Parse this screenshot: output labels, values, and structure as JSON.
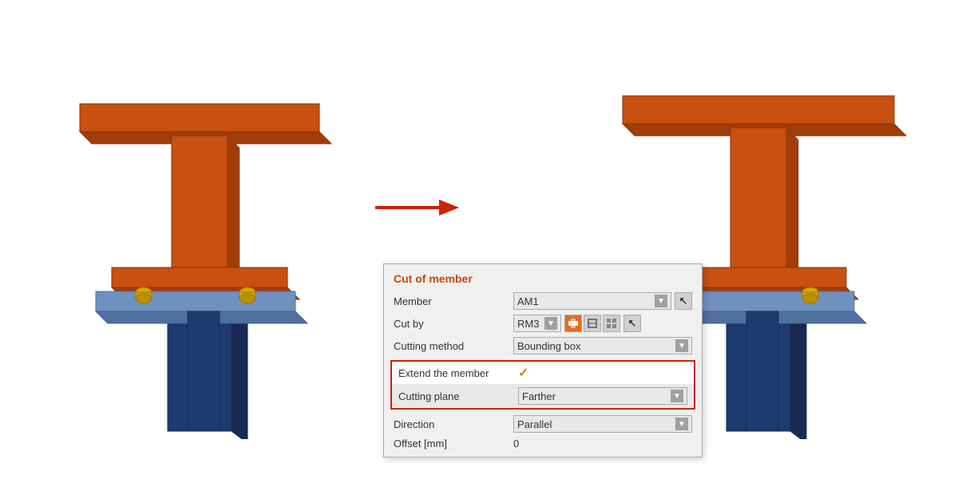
{
  "dialog": {
    "title": "Cut of member",
    "rows": [
      {
        "label": "Member",
        "value": "AM1",
        "type": "select"
      },
      {
        "label": "Cut by",
        "value": "RM3",
        "type": "select-icons"
      },
      {
        "label": "Cutting method",
        "value": "Bounding box",
        "type": "select"
      },
      {
        "label": "Extend the member",
        "value": "✓",
        "type": "check",
        "highlighted": true
      },
      {
        "label": "Cutting plane",
        "value": "Farther",
        "type": "select",
        "highlighted": true
      },
      {
        "label": "Direction",
        "value": "Parallel",
        "type": "select"
      },
      {
        "label": "Offset [mm]",
        "value": "0",
        "type": "text"
      }
    ]
  },
  "arrow": "→",
  "colors": {
    "beam_orange": "#c85010",
    "beam_plate_dark": "#1e3a6e",
    "beam_plate_light": "#7090c0",
    "bolt_yellow": "#d4a800",
    "title_color": "#cc4400",
    "arrow_color": "#cc2200"
  }
}
